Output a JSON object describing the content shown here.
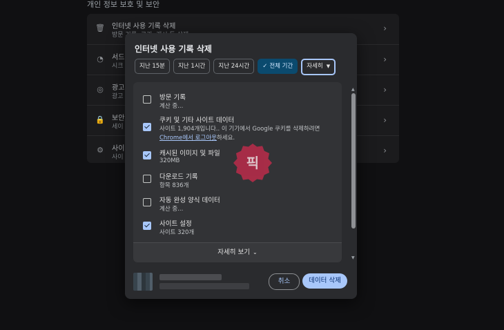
{
  "background_page": {
    "section_title": "개인 정보 보호 및 보안",
    "rows": [
      {
        "icon": "trash-icon",
        "glyph": "🗑",
        "title": "인터넷 사용 기록 삭제",
        "subtitle": "방문 기록, 쿠키, 캐시 등 삭제"
      },
      {
        "icon": "cookie-icon",
        "glyph": "◔",
        "title": "서드",
        "subtitle": "시크"
      },
      {
        "icon": "ads-icon",
        "glyph": "◎",
        "title": "광고",
        "subtitle": "광고"
      },
      {
        "icon": "lock-icon",
        "glyph": "🔒",
        "title": "보안",
        "subtitle": "세이"
      },
      {
        "icon": "tune-icon",
        "glyph": "⚙",
        "title": "사이",
        "subtitle": "사이"
      }
    ]
  },
  "dialog": {
    "title": "인터넷 사용 기록 삭제",
    "chips": {
      "c15": "지난 15분",
      "c1h": "지난 1시간",
      "c24h": "지난 24시간",
      "all": "전체 기간",
      "more": "자세히"
    },
    "options": [
      {
        "title": "방문 기록",
        "subtitle": "계산 중...",
        "checked": false
      },
      {
        "title": "쿠키 및 기타 사이트 데이터",
        "subtitle_line1": "사이트 1,904개입니다.. 이 기기에서 Google 쿠키를 삭제하려면",
        "subtitle_link": "Chrome에서 로그아웃",
        "subtitle_line2_rest": "하세요.",
        "checked": true
      },
      {
        "title": "캐시된 이미지 및 파일",
        "subtitle": "320MB",
        "checked": true
      },
      {
        "title": "다운로드 기록",
        "subtitle": "항목 836개",
        "checked": false
      },
      {
        "title": "자동 완성 양식 데이터",
        "subtitle": "계산 중...",
        "checked": false
      },
      {
        "title": "사이트 설정",
        "subtitle": "사이트 320개",
        "checked": true
      }
    ],
    "show_more": "자세히 보기",
    "cancel_label": "취소",
    "delete_label": "데이터 삭제"
  },
  "stamp_text": "픽",
  "colors": {
    "accent": "#a8c7fa",
    "selected_chip": "#0b4a6e",
    "stamp": "#b72c4a"
  }
}
